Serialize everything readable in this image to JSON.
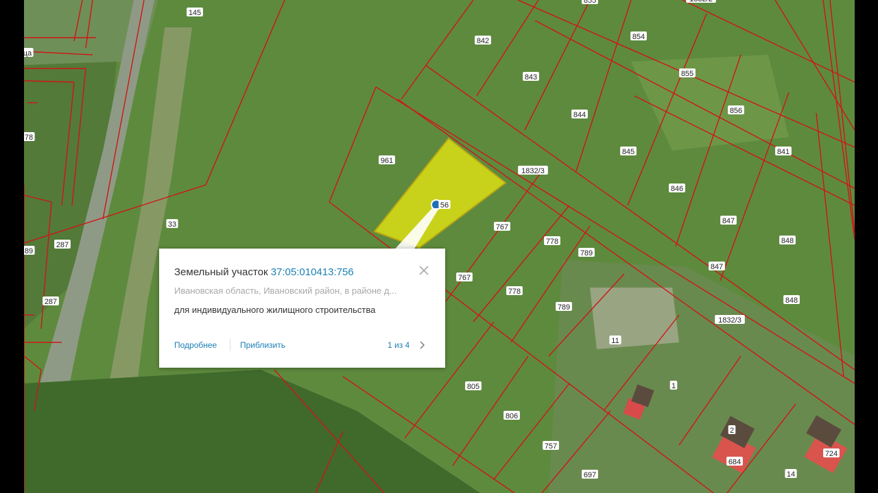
{
  "colors": {
    "grass": "#5f8c3d",
    "boundary": "#d01515",
    "selected_fill": "#c8d21a",
    "pin": "#1e6fb5"
  },
  "map": {
    "labels": [
      "145",
      "842",
      "843",
      "844",
      "845",
      "846",
      "847",
      "848",
      "854",
      "855",
      "856",
      "841",
      "961",
      "1832/3",
      "767",
      "778",
      "789",
      "33",
      "287",
      "287",
      "78",
      "89",
      "11",
      "1",
      "2",
      "805",
      "806",
      "757",
      "697",
      "14",
      "684",
      "724",
      "855",
      "1832/2",
      "847",
      "848",
      "767",
      "778",
      "789",
      "1832/3",
      "56",
      "ца"
    ]
  },
  "popup": {
    "title_prefix": "Земельный участок",
    "cadastral_number": "37:05:010413:756",
    "address": "Ивановская область, Ивановский район, в районе д...",
    "permitted_use": "для индивидуального жилищного строительства",
    "link_details": "Подробнее",
    "link_zoom": "Приблизить",
    "pager": "1 из 4",
    "close_icon": "close-icon",
    "next_icon": "chevron-right-icon"
  }
}
